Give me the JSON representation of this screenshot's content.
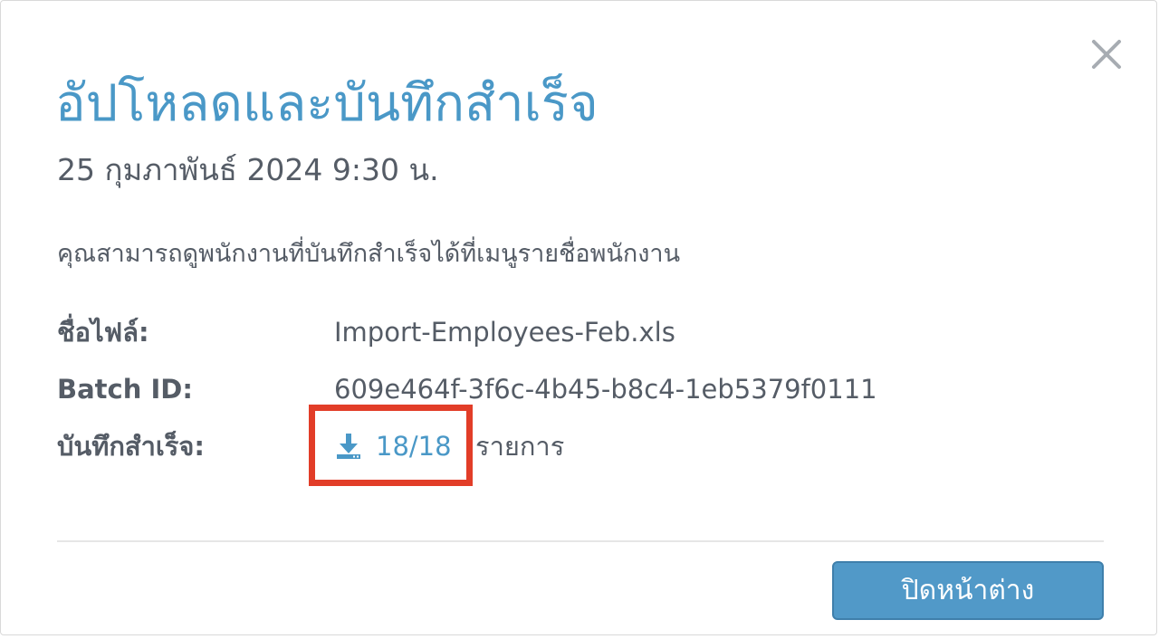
{
  "modal": {
    "title": "อัปโหลดและบันทึกสำเร็จ",
    "timestamp": "25 กุมภาพันธ์ 2024 9:30 น.",
    "description": "คุณสามารถดูพนักงานที่บันทึกสำเร็จได้ที่เมนูรายชื่อพนักงาน",
    "close_icon": "close-icon"
  },
  "details": {
    "filename": {
      "label": "ชื่อไฟล์:",
      "value": "Import-Employees-Feb.xls"
    },
    "batch": {
      "label": "Batch ID:",
      "value": "609e464f-3f6c-4b45-b8c4-1eb5379f0111"
    },
    "saved": {
      "label": "บันทึกสำเร็จ:",
      "unit": "รายการ"
    }
  },
  "download_link": {
    "icon": "download-icon",
    "count": "18/18"
  },
  "footer": {
    "close_button_label": "ปิดหน้าต่าง"
  },
  "colors": {
    "title": "#4a98c7",
    "text": "#555c66",
    "link": "#4a98c7",
    "close_icon": "#a7acb2",
    "highlight": "#e23d28",
    "divider": "#e6e6e6",
    "button_bg": "#5199c8",
    "button_border": "#3f7fab",
    "button_text": "#ffffff"
  }
}
